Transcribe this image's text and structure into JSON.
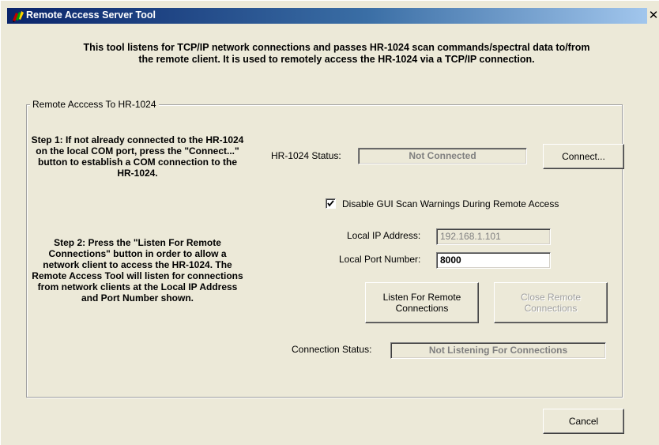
{
  "window": {
    "title": "Remote Access Server Tool",
    "close_label": "✕",
    "icon": "app-color-pencil-icon"
  },
  "description": "This tool listens for TCP/IP network connections and passes HR-1024 scan commands/spectral data to/from the remote client. It is used to remotely access the HR-1024 via a TCP/IP connection.",
  "group": {
    "label": "Remote Acccess To HR-1024",
    "step1": "Step 1: If not already connected to the HR-1024 on the local COM port, press the \"Connect...\" button to establish a COM connection to the HR-1024.",
    "step2": "Step 2: Press the \"Listen For Remote Connections\" button in order to allow a network client to access the HR-1024. The Remote Access Tool will listen for connections from network clients at the Local IP Address and Port Number shown.",
    "status_label": "HR-1024 Status:",
    "status_value": "Not Connected",
    "connect_button": "Connect...",
    "checkbox_label": "Disable GUI Scan Warnings During Remote Access",
    "checkbox_checked": true,
    "ip_label": "Local IP Address:",
    "ip_value": "192.168.1.101",
    "port_label": "Local Port Number:",
    "port_value": "8000",
    "listen_button": "Listen For Remote Connections",
    "close_button": "Close Remote Connections",
    "connection_label": "Connection Status:",
    "connection_value": "Not Listening For Connections"
  },
  "cancel_button": "Cancel"
}
